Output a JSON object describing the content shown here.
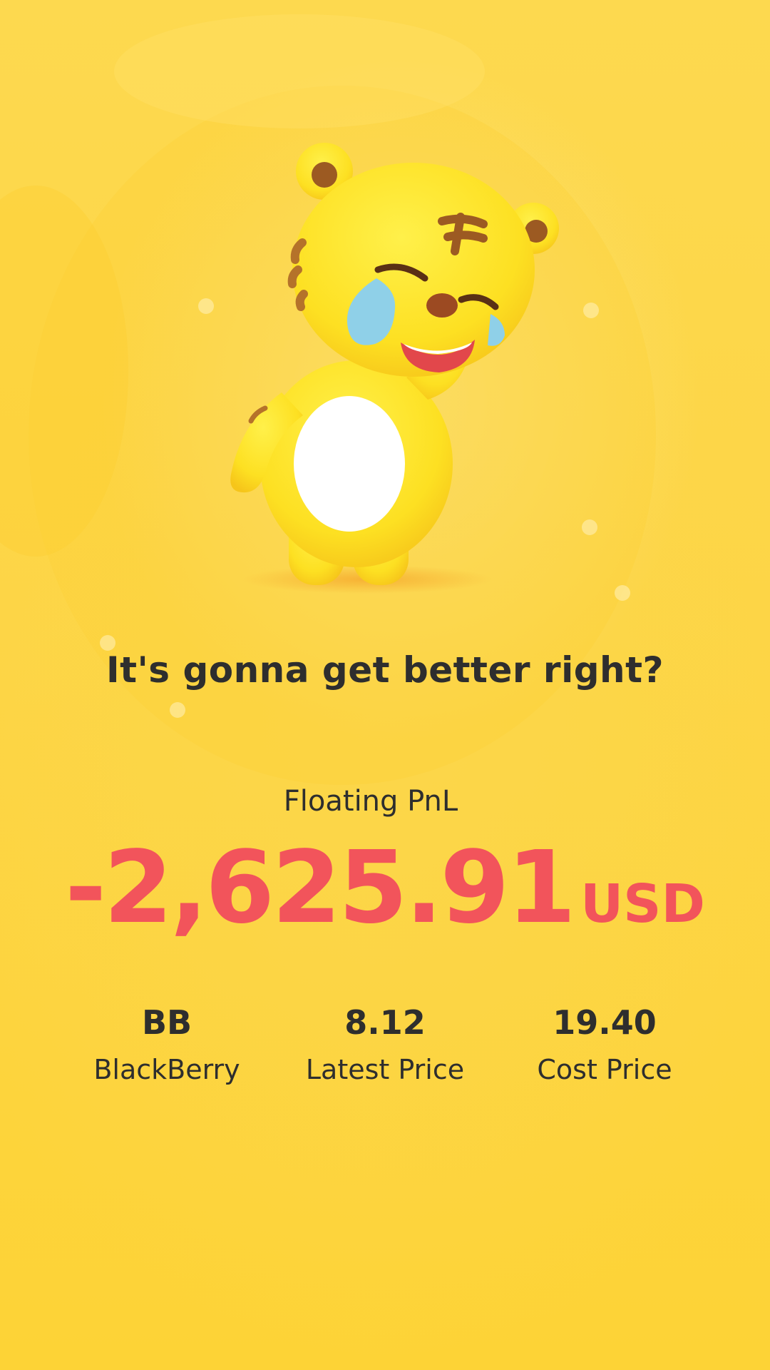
{
  "headline": "It's gonna get better right?",
  "pnl": {
    "label": "Floating PnL",
    "value": "-2,625.91",
    "currency": "USD",
    "color": "#f2545b"
  },
  "stats": [
    {
      "value": "BB",
      "label": "BlackBerry"
    },
    {
      "value": "8.12",
      "label": "Latest Price"
    },
    {
      "value": "19.40",
      "label": "Cost Price"
    }
  ],
  "colors": {
    "background": "#fdd545",
    "text": "#2e2e2e",
    "mascot_body": "#fde22a"
  },
  "mascot": {
    "icon": "crying-laughing-tiger-mascot"
  }
}
